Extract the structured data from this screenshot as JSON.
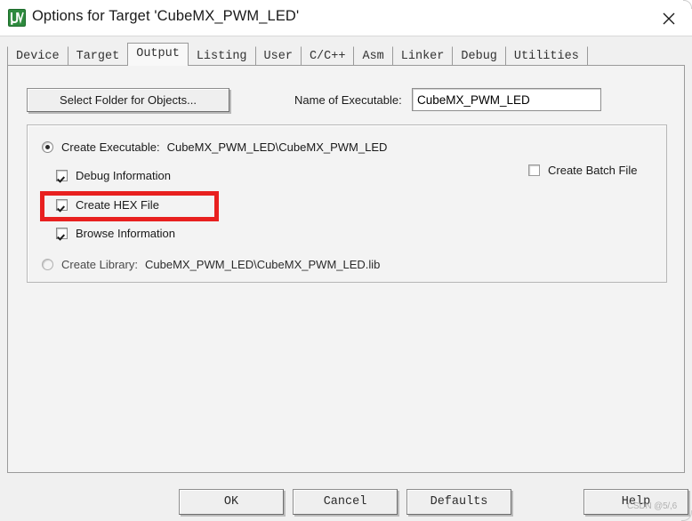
{
  "window": {
    "title": "Options for Target 'CubeMX_PWM_LED'",
    "icon": "keil-uvision-icon",
    "close_icon": "close-icon"
  },
  "tabs": [
    {
      "label": "Device",
      "active": false
    },
    {
      "label": "Target",
      "active": false
    },
    {
      "label": "Output",
      "active": true
    },
    {
      "label": "Listing",
      "active": false
    },
    {
      "label": "User",
      "active": false
    },
    {
      "label": "C/C++",
      "active": false
    },
    {
      "label": "Asm",
      "active": false
    },
    {
      "label": "Linker",
      "active": false
    },
    {
      "label": "Debug",
      "active": false
    },
    {
      "label": "Utilities",
      "active": false
    }
  ],
  "output_tab": {
    "select_folder_button": "Select Folder for Objects...",
    "executable_label": "Name of Executable:",
    "executable_value": "CubeMX_PWM_LED",
    "executable_placeholder": "Name of Executable",
    "create_executable": {
      "label": "Create Executable:",
      "path": "CubeMX_PWM_LED\\CubeMX_PWM_LED",
      "selected": "true"
    },
    "debug_information": {
      "label": "Debug Information",
      "checked": "true"
    },
    "create_hex_file": {
      "label": "Create HEX File",
      "checked": "true"
    },
    "browse_information": {
      "label": "Browse Information",
      "checked": "true"
    },
    "create_batch_file": {
      "label": "Create Batch File",
      "checked": "false"
    },
    "create_library": {
      "label": "Create Library:",
      "path": "CubeMX_PWM_LED\\CubeMX_PWM_LED.lib",
      "selected": "false"
    },
    "highlight_color": "#e8201f",
    "highlighted_option": "Create HEX File"
  },
  "footer": {
    "ok": "OK",
    "cancel": "Cancel",
    "defaults": "Defaults",
    "help": "Help"
  },
  "watermark": "CSDN @5/,6"
}
